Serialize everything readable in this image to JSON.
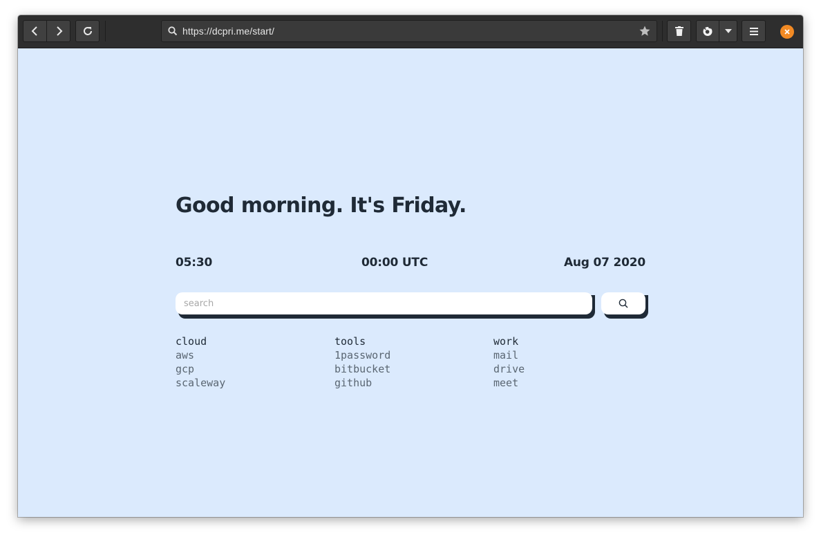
{
  "browser": {
    "url": "https://dcpri.me/start/",
    "icons": {
      "back": "chevron-left-icon",
      "forward": "chevron-right-icon",
      "reload": "reload-icon",
      "search": "search-icon",
      "bookmark": "star-icon",
      "trash": "trash-icon",
      "firefox": "firefox-icon",
      "dropdown": "caret-down-icon",
      "menu": "hamburger-menu-icon",
      "close": "close-icon"
    },
    "colors": {
      "toolbar": "#2e2e2e",
      "close_button": "#f28a24"
    }
  },
  "page": {
    "greeting": "Good morning. It's Friday.",
    "local_time": "05:30",
    "utc_time": "00:00 UTC",
    "date": "Aug 07 2020",
    "search": {
      "placeholder": "search",
      "value": ""
    },
    "background": "#dbeafd",
    "text_color": "#1f2a36",
    "link_groups": [
      {
        "heading": "cloud",
        "links": [
          "aws",
          "gcp",
          "scaleway"
        ]
      },
      {
        "heading": "tools",
        "links": [
          "1password",
          "bitbucket",
          "github"
        ]
      },
      {
        "heading": "work",
        "links": [
          "mail",
          "drive",
          "meet"
        ]
      }
    ]
  }
}
